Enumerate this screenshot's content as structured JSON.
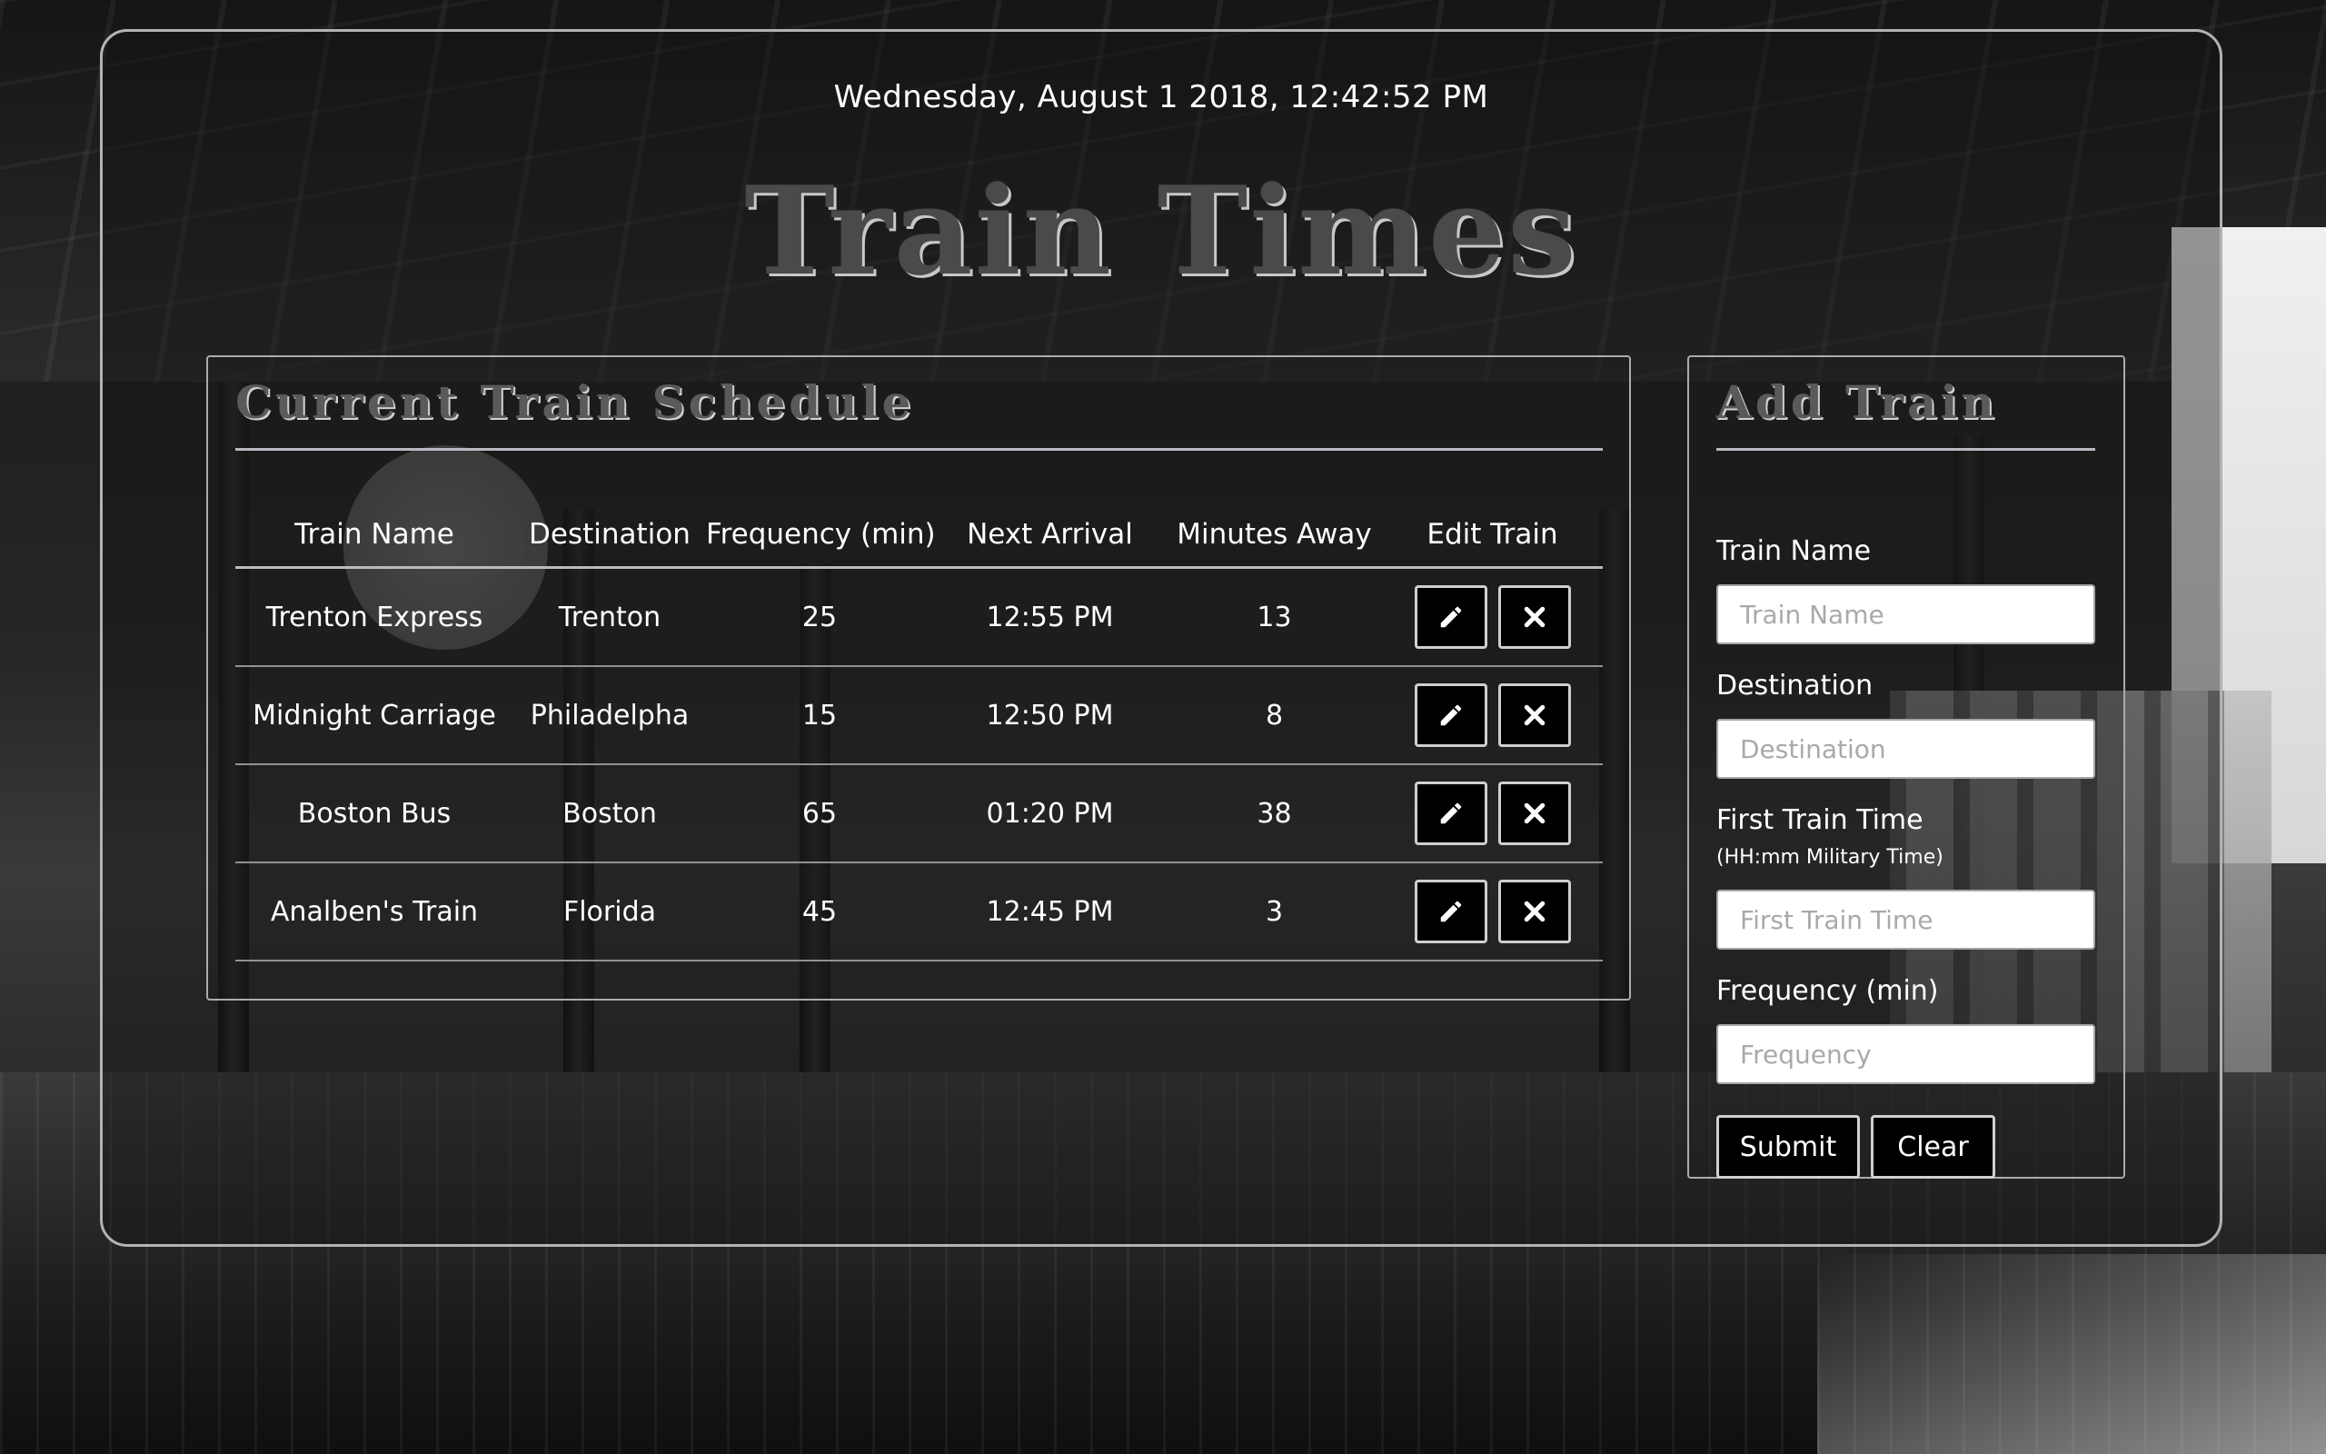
{
  "header": {
    "datetime": "Wednesday, August 1 2018, 12:42:52 PM",
    "title": "Train Times"
  },
  "schedule": {
    "title": "Current Train Schedule",
    "columns": [
      "Train Name",
      "Destination",
      "Frequency (min)",
      "Next Arrival",
      "Minutes Away",
      "Edit Train"
    ],
    "rows": [
      {
        "name": "Trenton Express",
        "destination": "Trenton",
        "frequency": "25",
        "next_arrival": "12:55 PM",
        "minutes_away": "13"
      },
      {
        "name": "Midnight Carriage",
        "destination": "Philadelpha",
        "frequency": "15",
        "next_arrival": "12:50 PM",
        "minutes_away": "8"
      },
      {
        "name": "Boston Bus",
        "destination": "Boston",
        "frequency": "65",
        "next_arrival": "01:20 PM",
        "minutes_away": "38"
      },
      {
        "name": "Analben's Train",
        "destination": "Florida",
        "frequency": "45",
        "next_arrival": "12:45 PM",
        "minutes_away": "3"
      }
    ],
    "edit_icon": "pencil-icon",
    "delete_icon": "x-icon"
  },
  "add_train": {
    "title": "Add Train",
    "name_label": "Train Name",
    "name_placeholder": "Train Name",
    "destination_label": "Destination",
    "destination_placeholder": "Destination",
    "first_time_label": "First Train Time",
    "first_time_hint": "(HH:mm Military Time)",
    "first_time_placeholder": "First Train Time",
    "frequency_label": "Frequency (min)",
    "frequency_placeholder": "Frequency",
    "submit_label": "Submit",
    "clear_label": "Clear"
  },
  "colors": {
    "border": "#b0b3b7",
    "button_bg": "#000000",
    "title_text": "#4a4a4a"
  }
}
